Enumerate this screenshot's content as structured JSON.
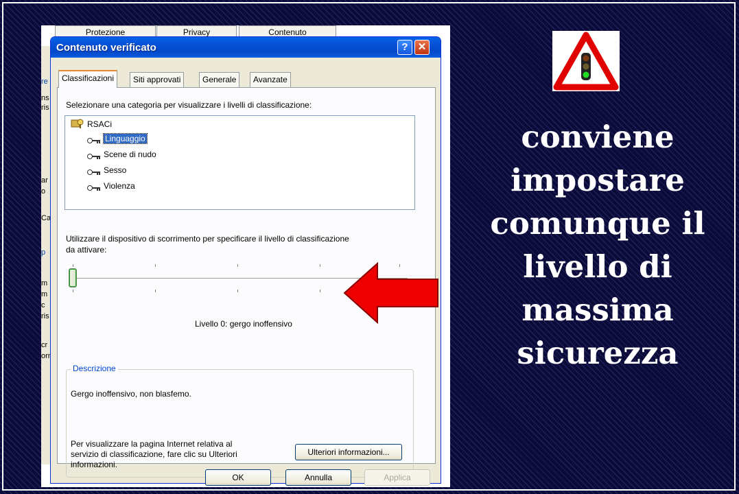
{
  "background_window": {
    "tabs": [
      "Protezione",
      "Privacy",
      "Contenuto"
    ],
    "fragments": [
      "re",
      "ns",
      "ris",
      "ar",
      "o",
      "Ca",
      "p",
      "m",
      "m",
      "c",
      "ris",
      "cr",
      "orr"
    ]
  },
  "dialog": {
    "title": "Contenuto verificato",
    "help_glyph": "?",
    "close_glyph": "✕",
    "tabs": [
      "Classificazioni",
      "Siti approvati",
      "Generale",
      "Avanzate"
    ],
    "active_tab": "Classificazioni",
    "category_prompt": "Selezionare una categoria per visualizzare i livelli di classificazione:",
    "tree": {
      "root": "RSACi",
      "items": [
        "Linguaggio",
        "Scene di nudo",
        "Sesso",
        "Violenza"
      ],
      "selected": "Linguaggio"
    },
    "slider_instruction_line1": "Utilizzare il dispositivo di scorrimento per specificare il livello di classificazione",
    "slider_instruction_line2": "da attivare:",
    "slider_level": 0,
    "level_label": "Livello 0:  gergo inoffensivo",
    "description_title": "Descrizione",
    "description_text": "Gergo inoffensivo, non blasfemo.",
    "info_text_line1": "Per visualizzare la pagina Internet relativa al",
    "info_text_line2": "servizio di classificazione, fare clic su Ulteriori",
    "info_text_line3": "informazioni.",
    "more_info_button": "Ulteriori informazioni...",
    "buttons": {
      "ok": "OK",
      "cancel": "Annulla",
      "apply": "Applica"
    }
  },
  "slide": {
    "text_lines": [
      "conviene",
      "impostare",
      "comunque il",
      "livello di",
      "massima",
      "sicurezza"
    ],
    "icon": "traffic-light-warning-sign",
    "colors": {
      "background": "#0b0b3a",
      "text": "#ffffff",
      "arrow": "#ee0000",
      "sign_border": "#e00000"
    }
  }
}
